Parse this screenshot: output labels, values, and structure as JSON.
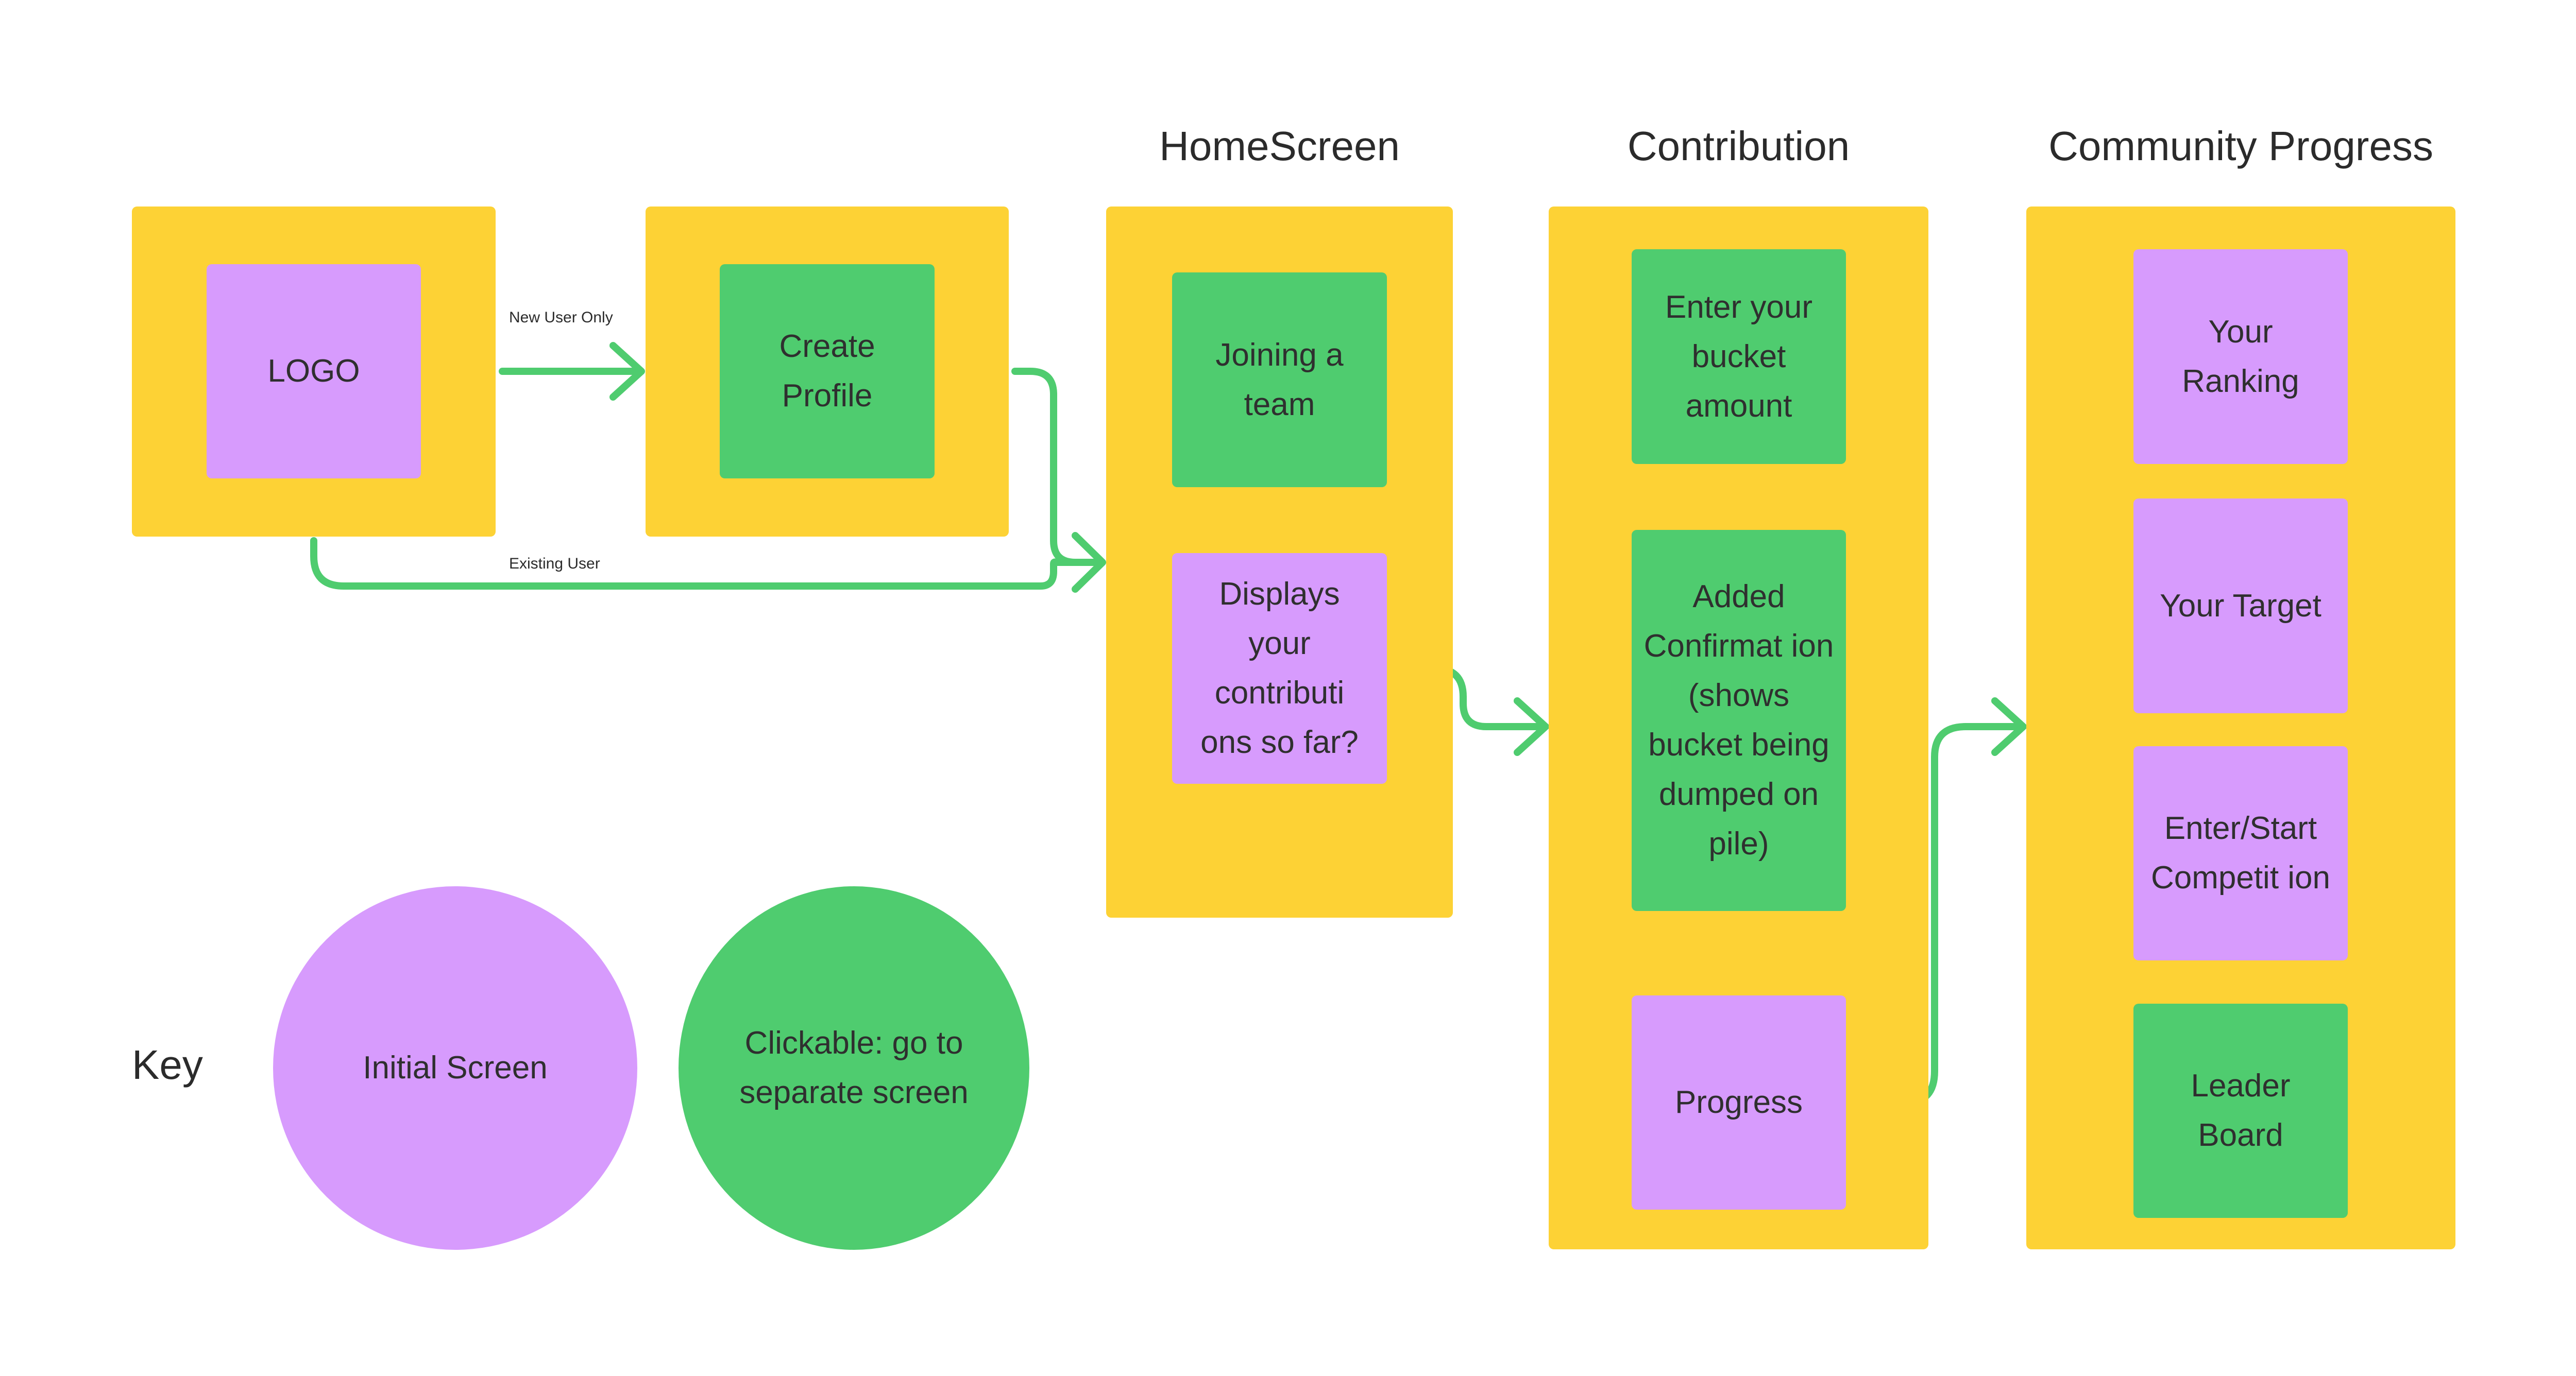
{
  "colors": {
    "frame": "#fdd235",
    "initial_screen": "#d79bfd",
    "clickable": "#4fcc6f",
    "connector": "#4fcc6f",
    "text": "#2b2b2b",
    "background": "#ffffff"
  },
  "screens": {
    "splash": {
      "card": {
        "label": "LOGO",
        "type": "initial_screen"
      }
    },
    "create_profile": {
      "card": {
        "label": "Create Profile",
        "type": "clickable"
      }
    },
    "homescreen": {
      "title": "HomeScreen",
      "cards": [
        {
          "label": "Joining a team",
          "type": "clickable"
        },
        {
          "label": "Displays your contributi ons so far?",
          "type": "initial_screen"
        }
      ]
    },
    "contribution": {
      "title": "Contribution",
      "cards": [
        {
          "label": "Enter your bucket amount",
          "type": "clickable"
        },
        {
          "label": "Added Confirmat ion (shows bucket being dumped on pile)",
          "type": "clickable"
        },
        {
          "label": "Progress",
          "type": "initial_screen"
        }
      ]
    },
    "community_progress": {
      "title": "Community Progress",
      "cards": [
        {
          "label": "Your Ranking",
          "type": "initial_screen"
        },
        {
          "label": "Your Target",
          "type": "initial_screen"
        },
        {
          "label": "Enter/Start Competit ion",
          "type": "initial_screen"
        },
        {
          "label": "Leader Board",
          "type": "clickable"
        }
      ]
    }
  },
  "connectors": [
    {
      "from": "LOGO",
      "to": "Create Profile",
      "label": "New User Only"
    },
    {
      "from": "LOGO",
      "to": "HomeScreen",
      "label": "Existing User"
    },
    {
      "from": "Create Profile",
      "to": "HomeScreen",
      "label": ""
    },
    {
      "from": "Displays your contributions so far?",
      "to": "Contribution",
      "label": ""
    },
    {
      "from": "Progress",
      "to": "Community Progress",
      "label": ""
    }
  ],
  "key": {
    "label": "Key",
    "items": [
      {
        "label": "Initial Screen",
        "type": "initial_screen"
      },
      {
        "label": "Clickable: go to separate screen",
        "type": "clickable"
      }
    ]
  }
}
